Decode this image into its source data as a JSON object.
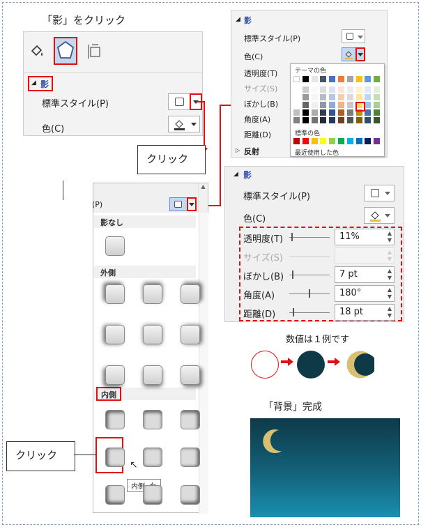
{
  "caption_shadow_click": "「影」をクリック",
  "panel1": {
    "section": "影",
    "preset_label": "標準スタイル(P)",
    "color_label": "色(C)"
  },
  "callout_click_1": "クリック",
  "callout_click_2": "クリック",
  "palette_panel": {
    "section": "影",
    "preset_label": "標準スタイル(P)",
    "color_label": "色(C)",
    "transparency_label": "透明度(T)",
    "size_label": "サイズ(S)",
    "blur_label": "ぼかし(B)",
    "angle_label": "角度(A)",
    "distance_label": "距離(D)",
    "mirror_label": "反射",
    "theme_colors_title": "テーマの色",
    "standard_colors_title": "標準の色",
    "recent_colors_title": "最近使用した色",
    "theme_colors": [
      "#ffffff",
      "#000000",
      "#e7e6e6",
      "#44546a",
      "#4472c4",
      "#ed7d31",
      "#a5a5a5",
      "#ffc000",
      "#5b9bd5",
      "#70ad47"
    ],
    "standard_colors": [
      "#c00000",
      "#ff0000",
      "#ffc000",
      "#ffff00",
      "#92d050",
      "#00b050",
      "#00b0f0",
      "#0070c0",
      "#002060",
      "#7030a0"
    ]
  },
  "gallery": {
    "header_label": "(P)",
    "none_title": "影なし",
    "outer_title": "外側",
    "inner_title": "内側",
    "tooltip": "内側: 左"
  },
  "panel3": {
    "section": "影",
    "preset_label": "標準スタイル(P)",
    "color_label": "色(C)",
    "transparency_label": "透明度(T)",
    "transparency_value": "11%",
    "size_label": "サイズ(S)",
    "blur_label": "ぼかし(B)",
    "blur_value": "7 pt",
    "angle_label": "角度(A)",
    "angle_value": "180°",
    "distance_label": "距離(D)",
    "distance_value": "18 pt"
  },
  "example_caption": "数値は１例です",
  "background_caption": "「背景」完成",
  "colors": {
    "accent_red": "#e01010",
    "moon_yellow": "#d8c070",
    "night_dark": "#0e3a48",
    "night_light": "#1a8fb0"
  }
}
